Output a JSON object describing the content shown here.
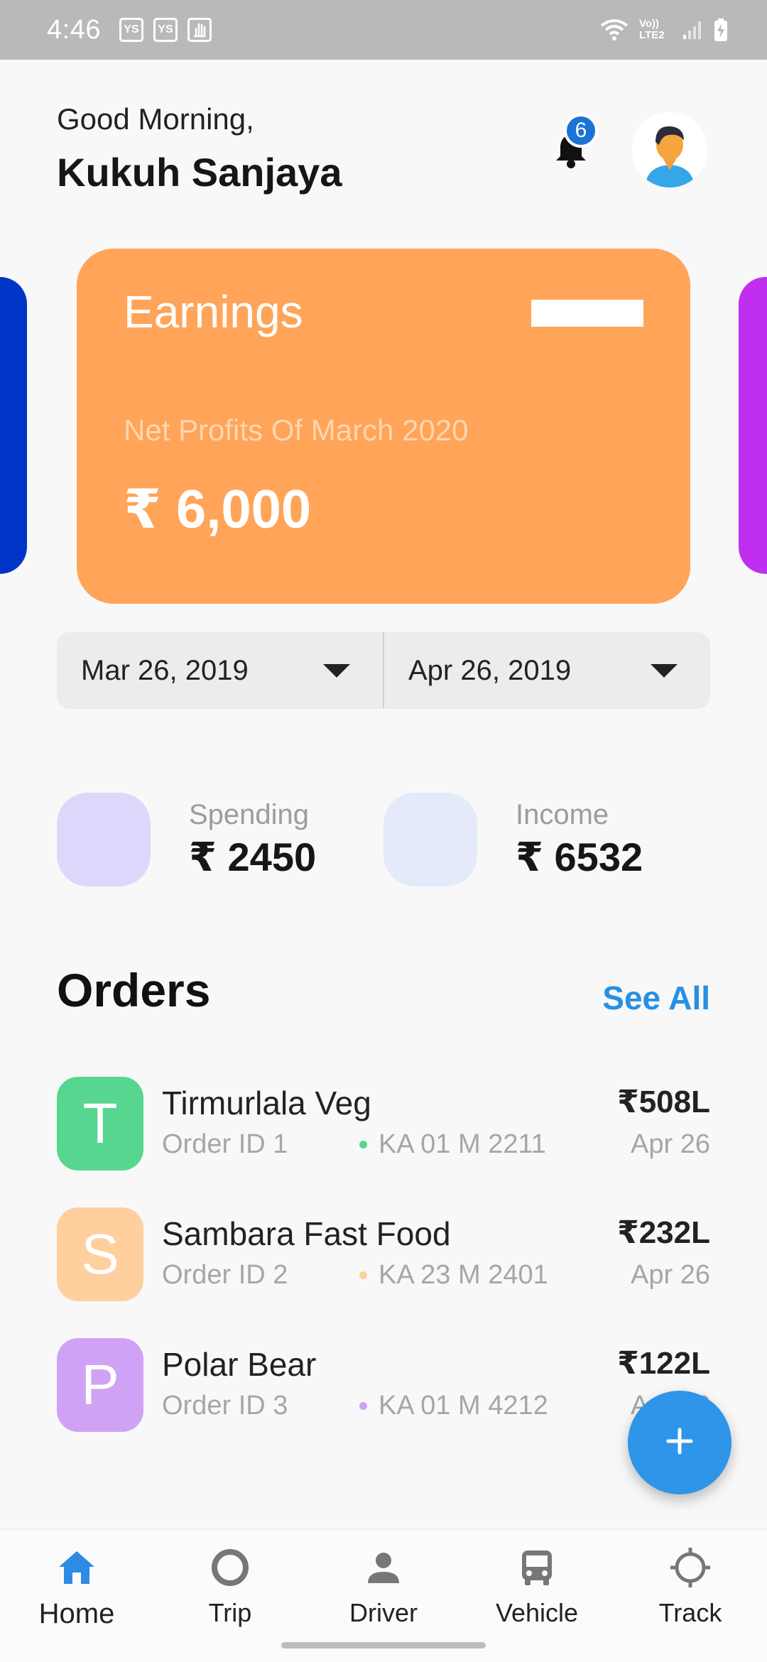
{
  "status_bar": {
    "time": "4:46",
    "notif_icons": [
      "YS",
      "YS",
      "hand-icon"
    ],
    "network": "Vo)) LTE2"
  },
  "header": {
    "greeting": "Good Morning,",
    "user_name": "Kukuh Sanjaya",
    "notification_count": "6"
  },
  "earnings_card": {
    "title": "Earnings",
    "subtitle": "Net Profits Of March 2020",
    "amount": "₹ 6,000",
    "color": "#ffa458"
  },
  "carousel": {
    "prev_card_color": "#0035c8",
    "next_card_color": "#c02ff0"
  },
  "date_range": {
    "start": "Mar 26, 2019",
    "end": "Apr 26, 2019"
  },
  "stats": {
    "spending": {
      "label": "Spending",
      "value": "₹ 2450",
      "color": "#ddd8fb"
    },
    "income": {
      "label": "Income",
      "value": "₹ 6532",
      "color": "#e4eaf9"
    }
  },
  "orders": {
    "title": "Orders",
    "see_all": "See All",
    "items": [
      {
        "initial": "T",
        "name": "Tirmurlala Veg",
        "order_id": "Order ID 1",
        "plate": "KA 01 M 2211",
        "amount": "₹508L",
        "date": "Apr 26",
        "color": "#57d690",
        "dot_color": "#57d690"
      },
      {
        "initial": "S",
        "name": "Sambara Fast Food",
        "order_id": "Order ID 2",
        "plate": "KA 23 M 2401",
        "amount": "₹232L",
        "date": "Apr 26",
        "color": "#ffcf9e",
        "dot_color": "#ffcf9e"
      },
      {
        "initial": "P",
        "name": "Polar Bear",
        "order_id": "Order ID 3",
        "plate": "KA 01 M 4212",
        "amount": "₹122L",
        "date": "Apr 26",
        "color": "#cfa2f6",
        "dot_color": "#cfa2f6"
      }
    ]
  },
  "fab": {
    "icon": "plus-icon"
  },
  "bottom_nav": {
    "active": "home",
    "accent": "#2f8ae6",
    "items": [
      {
        "id": "home",
        "label": "Home",
        "icon": "home-icon"
      },
      {
        "id": "trip",
        "label": "Trip",
        "icon": "circle-icon"
      },
      {
        "id": "driver",
        "label": "Driver",
        "icon": "person-icon"
      },
      {
        "id": "vehicle",
        "label": "Vehicle",
        "icon": "bus-icon"
      },
      {
        "id": "track",
        "label": "Track",
        "icon": "crosshair-icon"
      }
    ]
  }
}
